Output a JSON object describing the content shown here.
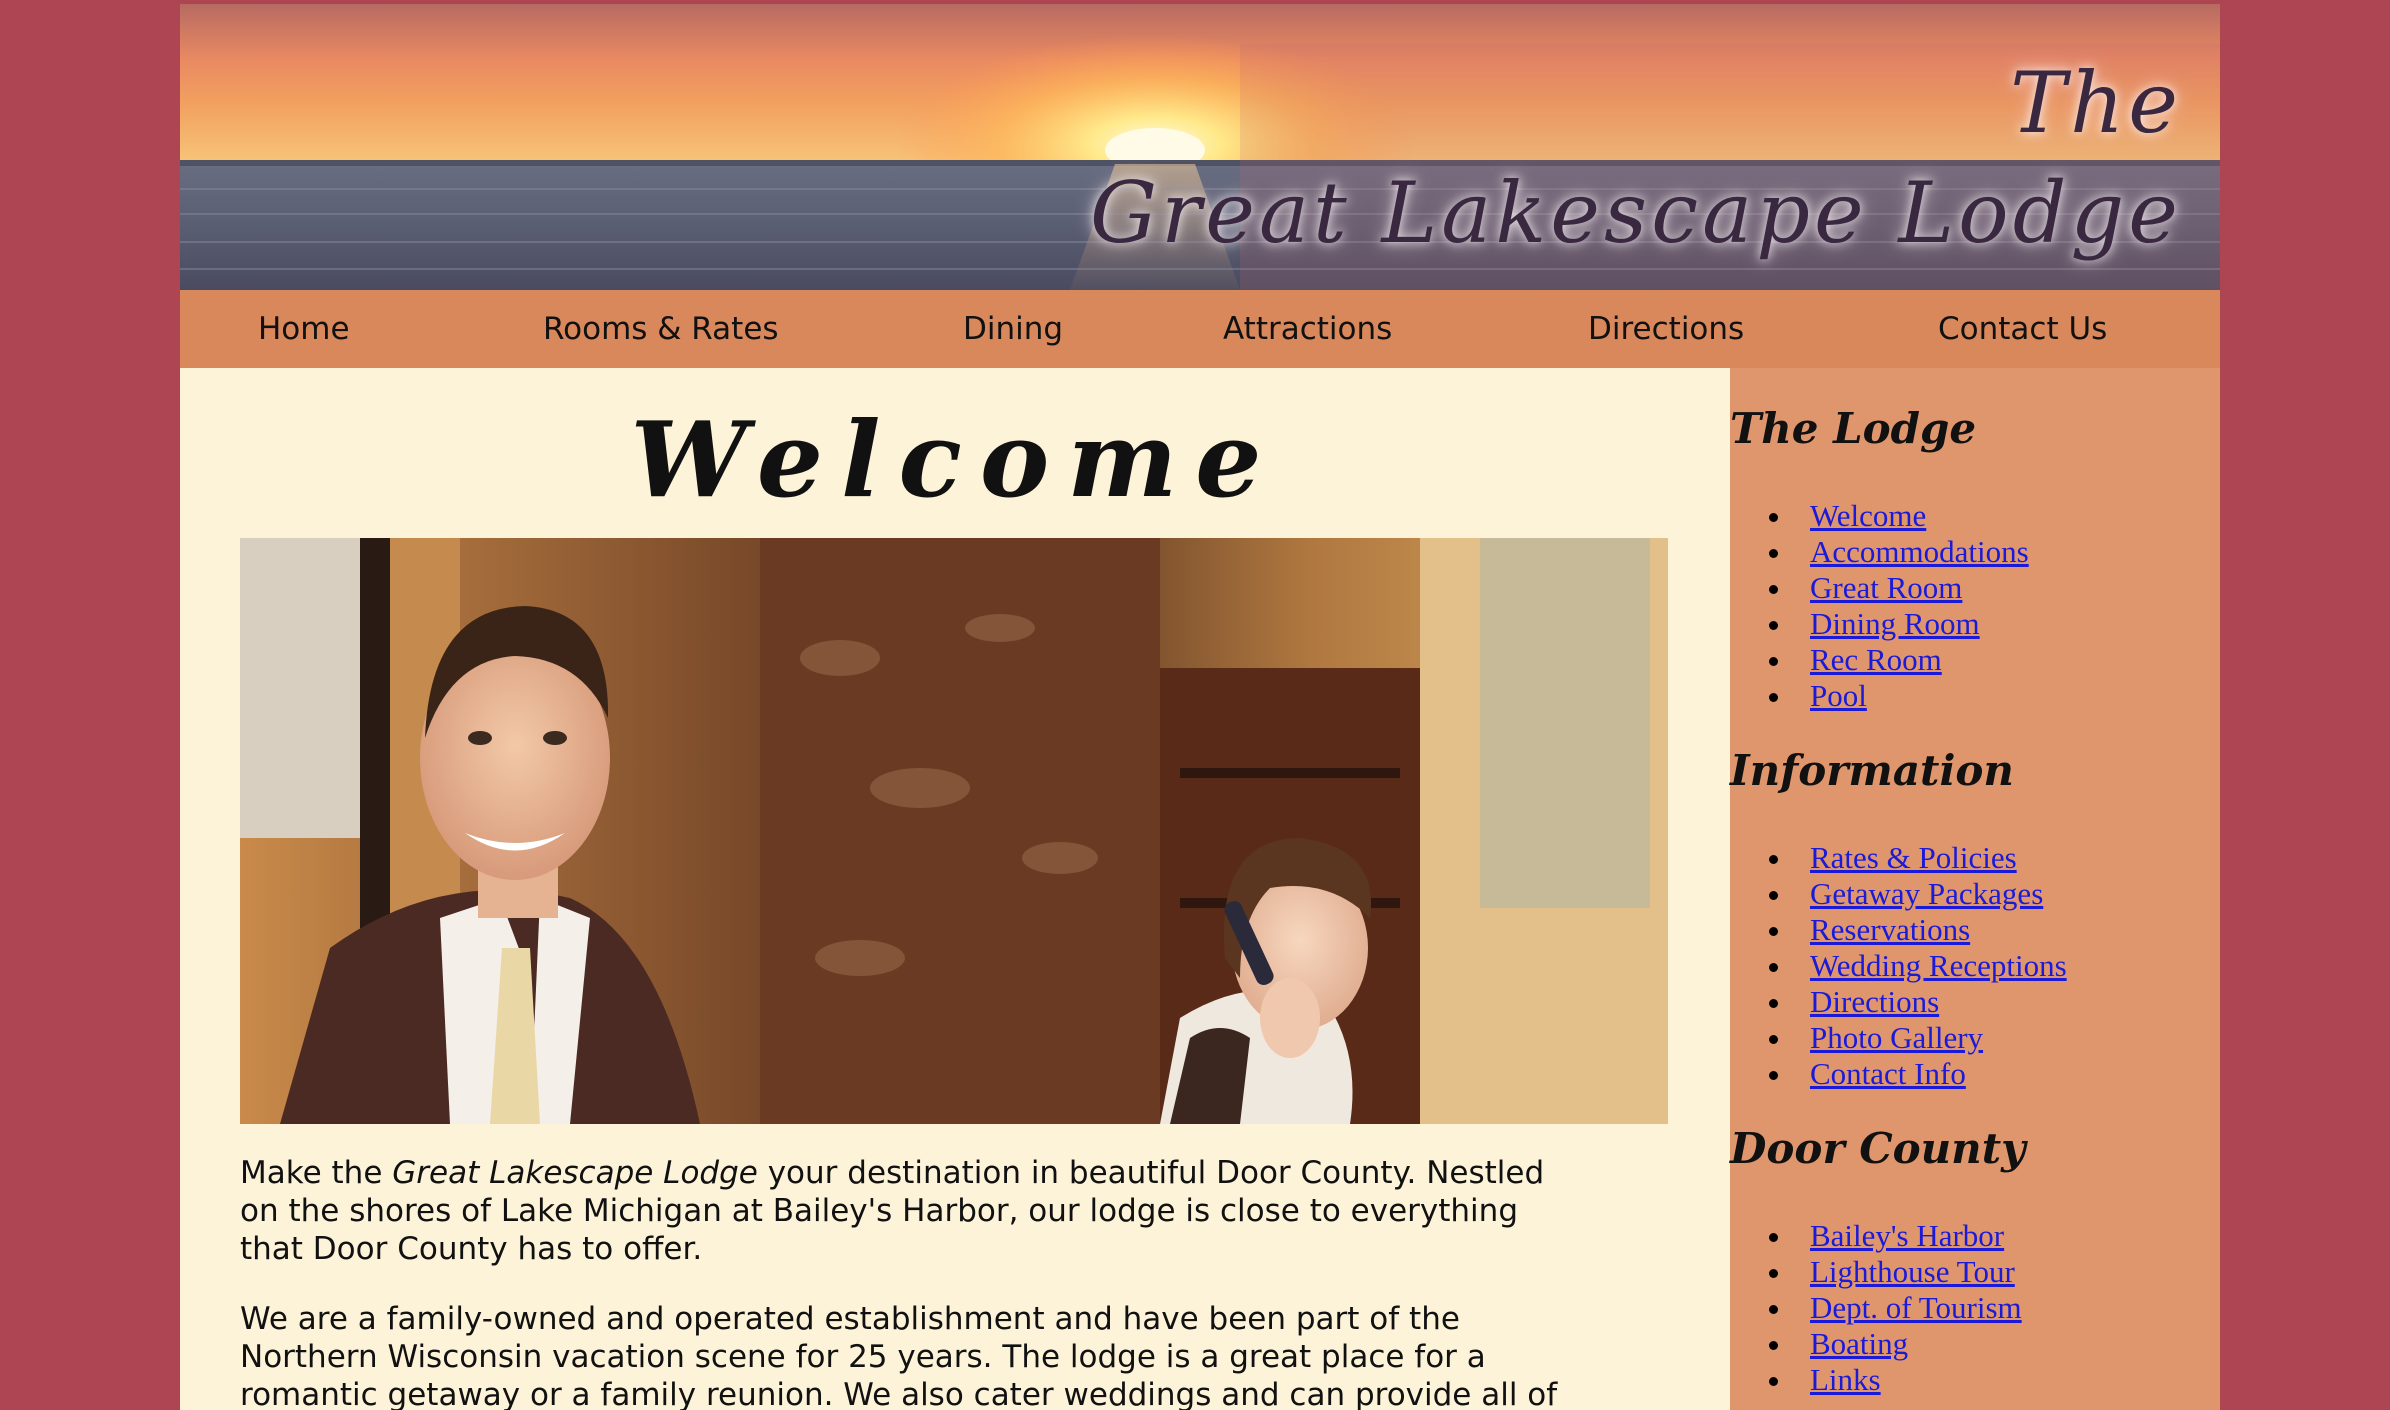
{
  "site": {
    "title_line1": "The",
    "title_line2": "Great Lakescape Lodge"
  },
  "nav": {
    "items": [
      "Home",
      "Rooms & Rates",
      "Dining",
      "Attractions",
      "Directions",
      "Contact Us"
    ]
  },
  "main": {
    "heading": "Welcome",
    "photo_alt": "Smiling front desk clerks at the lodge reception",
    "p1_before": "Make the ",
    "p1_emphasis": "Great Lakescape Lodge",
    "p1_after": " your destination in beautiful Door County. Nestled on the shores of Lake Michigan at Bailey's Harbor, our lodge is close to everything that Door County has to offer.",
    "p2": "We are a family-owned and operated establishment and have been part of the Northern Wisconsin vacation scene for 25 years. The lodge is a great place for a romantic getaway or a family reunion. We also cater weddings and can provide all of the amenities to make your"
  },
  "sidebar": {
    "sections": [
      {
        "heading": "The Lodge",
        "links": [
          "Welcome",
          "Accommodations",
          "Great Room",
          "Dining Room",
          "Rec Room",
          "Pool"
        ]
      },
      {
        "heading": "Information",
        "links": [
          "Rates & Policies",
          "Getaway Packages",
          "Reservations",
          "Wedding Receptions",
          "Directions",
          "Photo Gallery",
          "Contact Info"
        ]
      },
      {
        "heading": "Door County",
        "links": [
          "Bailey's Harbor",
          "Lighthouse Tour",
          "Dept. of Tourism",
          "Boating",
          "Links"
        ]
      }
    ]
  },
  "colors": {
    "outer_background": "#ad4553",
    "content_background": "#fdf3d9",
    "nav_background": "#d9885c",
    "sidebar_background": "#e0966c",
    "link_color": "#1a1ad8"
  }
}
